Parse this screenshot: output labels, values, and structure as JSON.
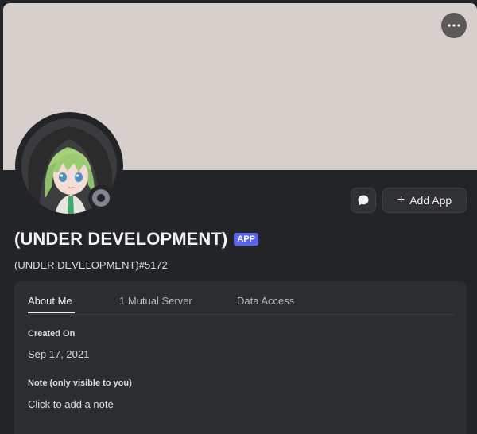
{
  "profile": {
    "display_name": "(UNDER DEVELOPMENT)",
    "badge": "APP",
    "username": "(UNDER DEVELOPMENT)#5172",
    "avatar_icon": "anime-character-avatar",
    "status": "offline",
    "banner_color": "#d6cfcb"
  },
  "actions": {
    "more_icon": "ellipsis-icon",
    "message_icon": "speech-bubble-icon",
    "add_app_label": "Add App",
    "add_app_icon": "plus-icon"
  },
  "tabs": [
    {
      "label": "About Me",
      "active": true
    },
    {
      "label": "1 Mutual Server",
      "active": false
    },
    {
      "label": "Data Access",
      "active": false
    }
  ],
  "about": {
    "created_on_label": "Created On",
    "created_on_value": "Sep 17, 2021",
    "note_label": "Note (only visible to you)",
    "note_placeholder": "Click to add a note"
  },
  "colors": {
    "accent": "#5865f2",
    "background": "#232428",
    "panel": "#2b2d31"
  }
}
